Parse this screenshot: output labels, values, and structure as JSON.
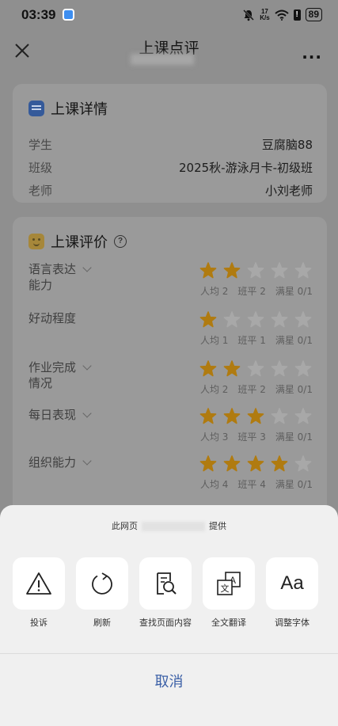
{
  "status_bar": {
    "time": "03:39",
    "speed_top": "17",
    "speed_bottom": "K/s",
    "battery": "89"
  },
  "nav": {
    "title": "上课点评",
    "more": "···"
  },
  "class_details": {
    "title": "上课详情",
    "rows": [
      {
        "key": "学生",
        "value": "豆腐脑88"
      },
      {
        "key": "班级",
        "value": "2025秋-游泳月卡-初级班"
      },
      {
        "key": "老师",
        "value": "小刘老师"
      }
    ]
  },
  "class_eval": {
    "title": "上课评价",
    "help": "?",
    "items": [
      {
        "label_line1": "语言表达",
        "label_line2": "能力",
        "has_chevron": true,
        "rating": 2,
        "avg": "人均 2",
        "class_avg": "班平 2",
        "full": "满星 0/1"
      },
      {
        "label_line1": "好动程度",
        "label_line2": "",
        "has_chevron": false,
        "rating": 1,
        "avg": "人均 1",
        "class_avg": "班平 1",
        "full": "满星 0/1"
      },
      {
        "label_line1": "作业完成",
        "label_line2": "情况",
        "has_chevron": true,
        "rating": 2,
        "avg": "人均 2",
        "class_avg": "班平 2",
        "full": "满星 0/1"
      },
      {
        "label_line1": "每日表现",
        "label_line2": "",
        "has_chevron": true,
        "rating": 3,
        "avg": "人均 3",
        "class_avg": "班平 3",
        "full": "满星 0/1"
      },
      {
        "label_line1": "组织能力",
        "label_line2": "",
        "has_chevron": true,
        "rating": 4,
        "avg": "人均 4",
        "class_avg": "班平 4",
        "full": "满星 0/1"
      }
    ],
    "max_rating": 5,
    "star_color": "#b07b10",
    "empty_star_color": "#a8a8a8"
  },
  "sheet": {
    "source_prefix": "此网页",
    "source_suffix": "提供",
    "actions": [
      {
        "name": "report",
        "icon": "warning-icon",
        "label": "投诉"
      },
      {
        "name": "refresh",
        "icon": "refresh-icon",
        "label": "刷新"
      },
      {
        "name": "find",
        "icon": "find-in-page-icon",
        "label": "查找页面内容"
      },
      {
        "name": "translate",
        "icon": "translate-icon",
        "label": "全文翻译"
      },
      {
        "name": "font",
        "icon": "font-size-icon",
        "label": "调整字体"
      }
    ],
    "cancel": "取消",
    "accent": "#3a5fa6"
  }
}
